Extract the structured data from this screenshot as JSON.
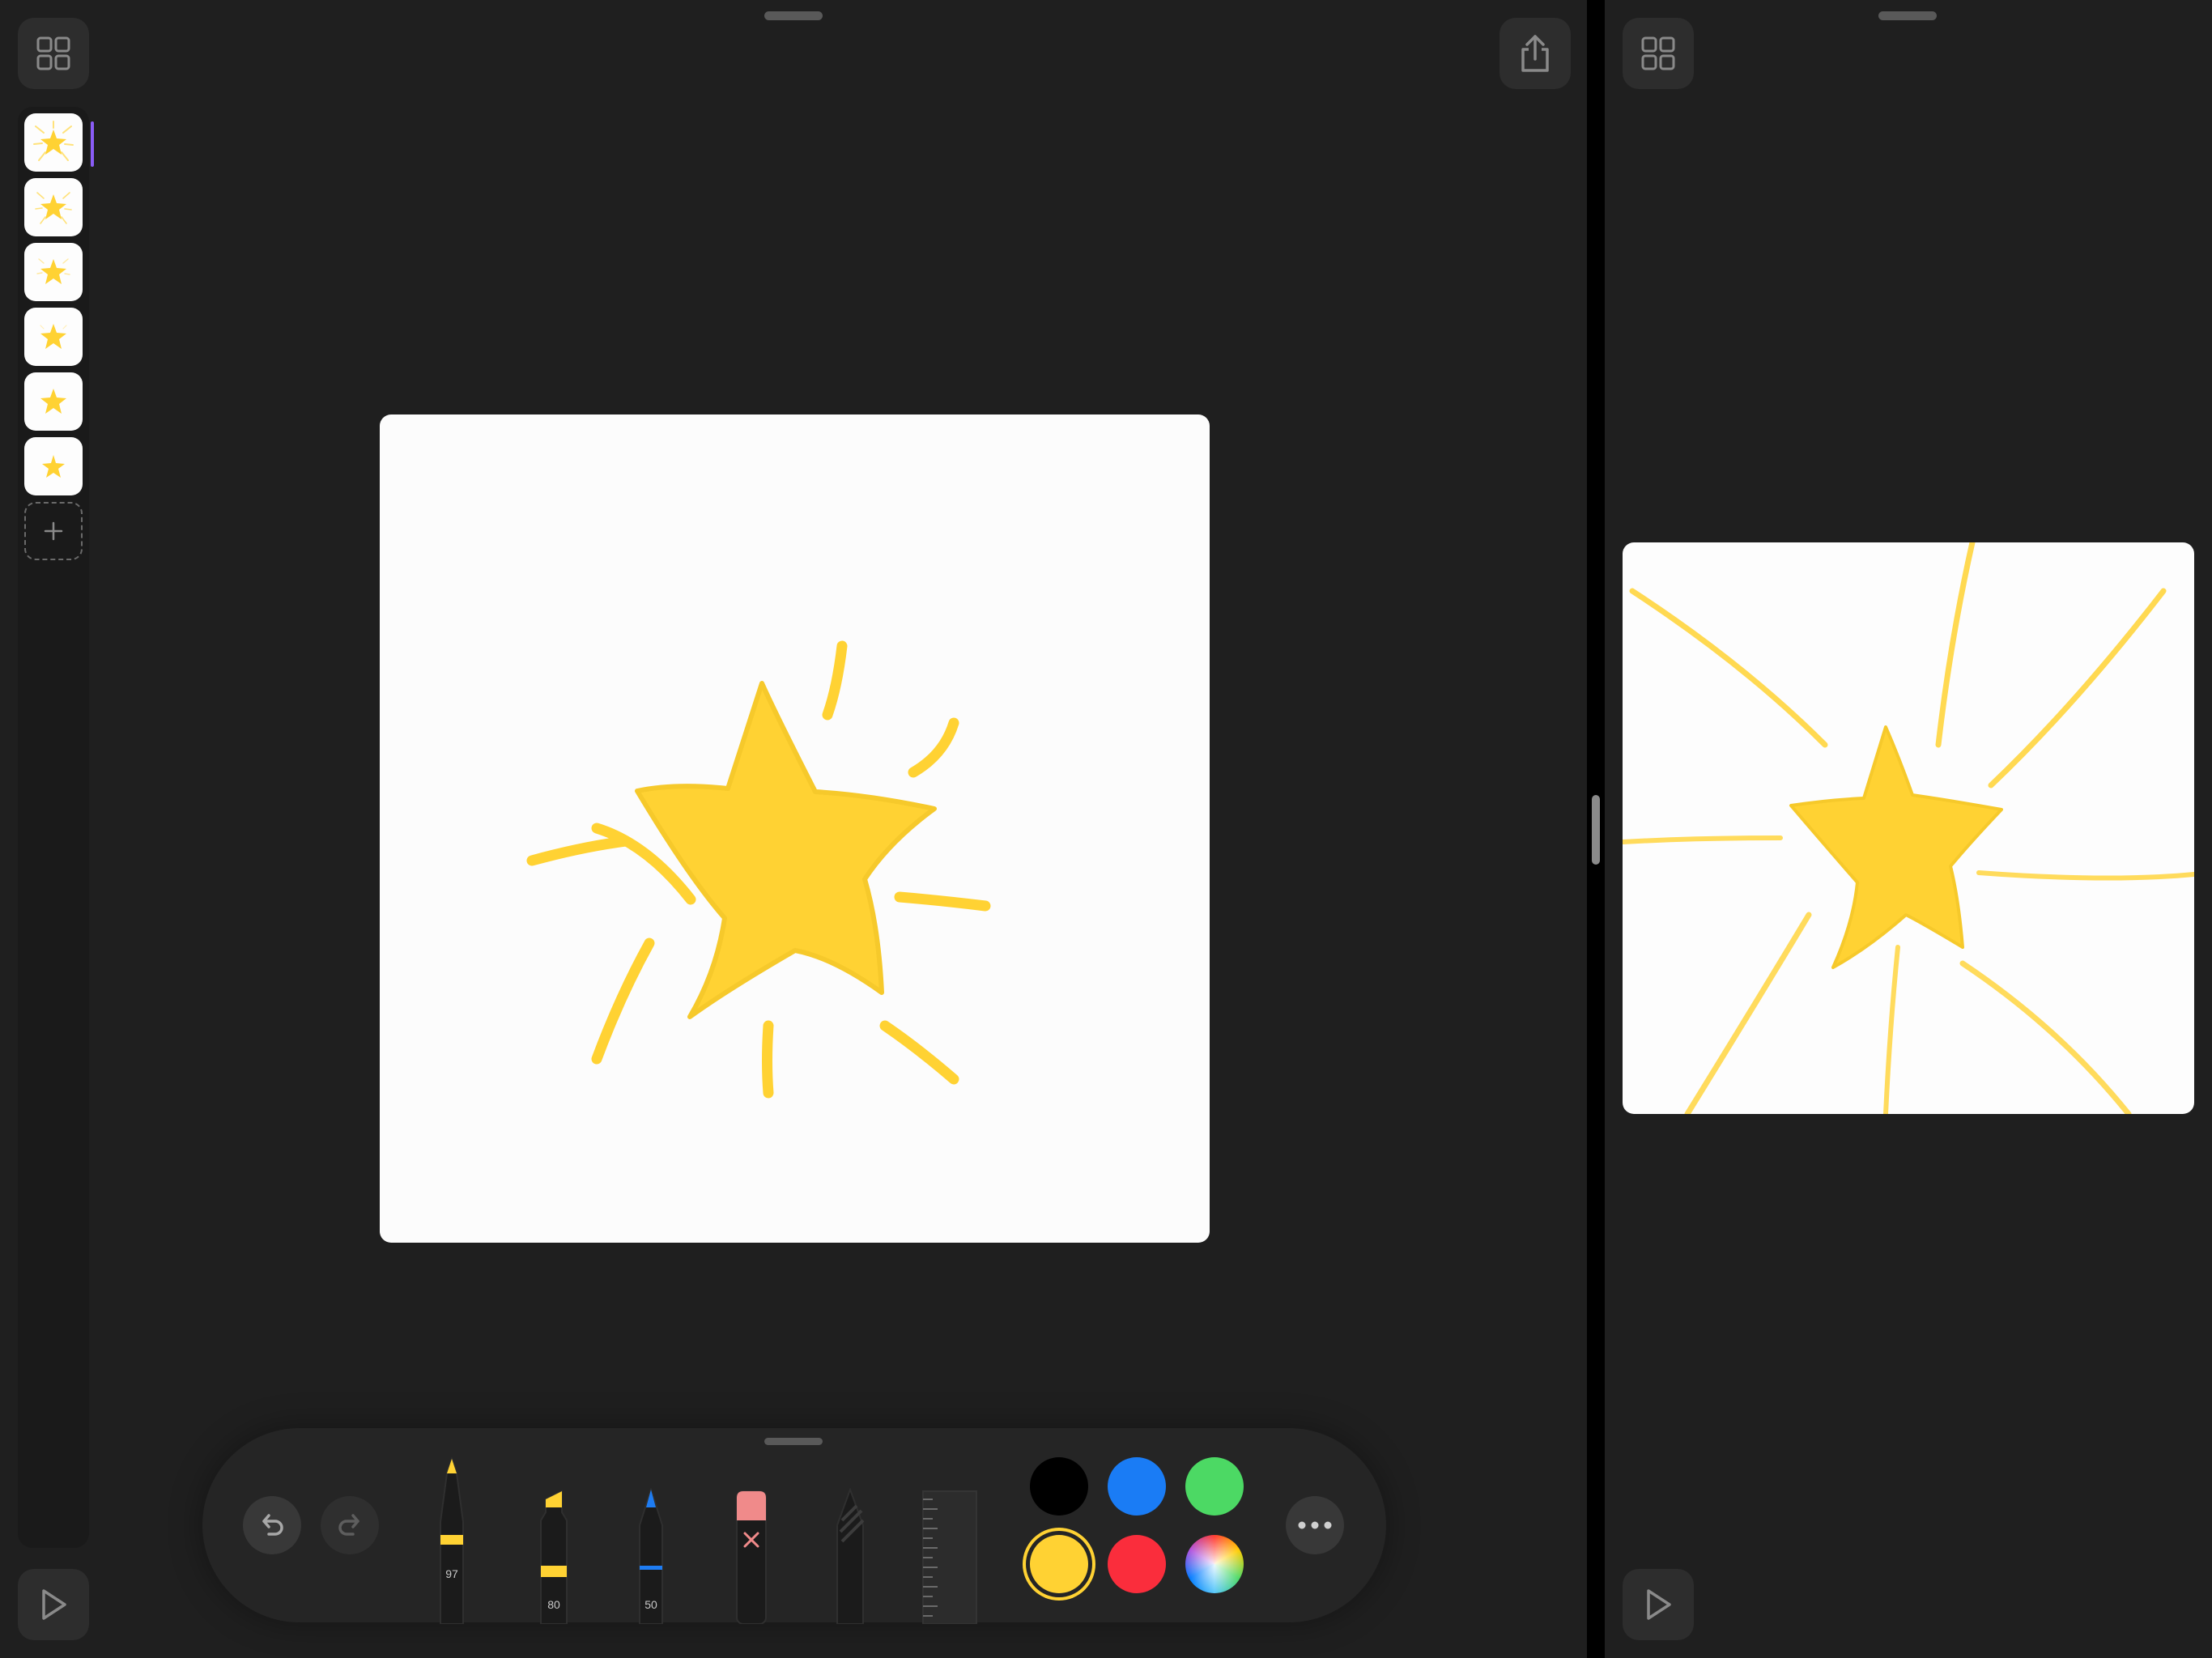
{
  "app": {
    "left_panel": {
      "gallery_icon": "grid-icon",
      "share_icon": "share-icon",
      "play_icon": "play-icon"
    },
    "right_panel": {
      "gallery_icon": "grid-icon",
      "play_icon": "play-icon"
    }
  },
  "frames": {
    "count": 6,
    "selected_index": 0,
    "add_icon": "plus-icon"
  },
  "drawing": {
    "subject": "star-icon",
    "stroke_color": "#ffd233",
    "canvas_color": "#fcfcfc"
  },
  "toolbar": {
    "undo_icon": "undo-icon",
    "redo_icon": "redo-icon",
    "more_icon": "more-icon",
    "tools": [
      {
        "name": "pen",
        "label": "97",
        "accent": "#ffd233"
      },
      {
        "name": "marker",
        "label": "80",
        "accent": "#ffd233"
      },
      {
        "name": "pencil",
        "label": "50",
        "accent": "#1e7cf2"
      },
      {
        "name": "eraser",
        "label": "",
        "accent": "#f08a8a"
      },
      {
        "name": "lasso",
        "label": "",
        "accent": "#3a3a3a"
      },
      {
        "name": "ruler",
        "label": "",
        "accent": "#3a3a3a"
      }
    ],
    "colors": [
      {
        "name": "black",
        "hex": "#000000"
      },
      {
        "name": "blue",
        "hex": "#1a7cf5"
      },
      {
        "name": "green",
        "hex": "#4cd964"
      },
      {
        "name": "yellow",
        "hex": "#ffd233",
        "selected": true
      },
      {
        "name": "red",
        "hex": "#fa2d3c"
      },
      {
        "name": "multicolor",
        "hex": "conic"
      }
    ]
  }
}
